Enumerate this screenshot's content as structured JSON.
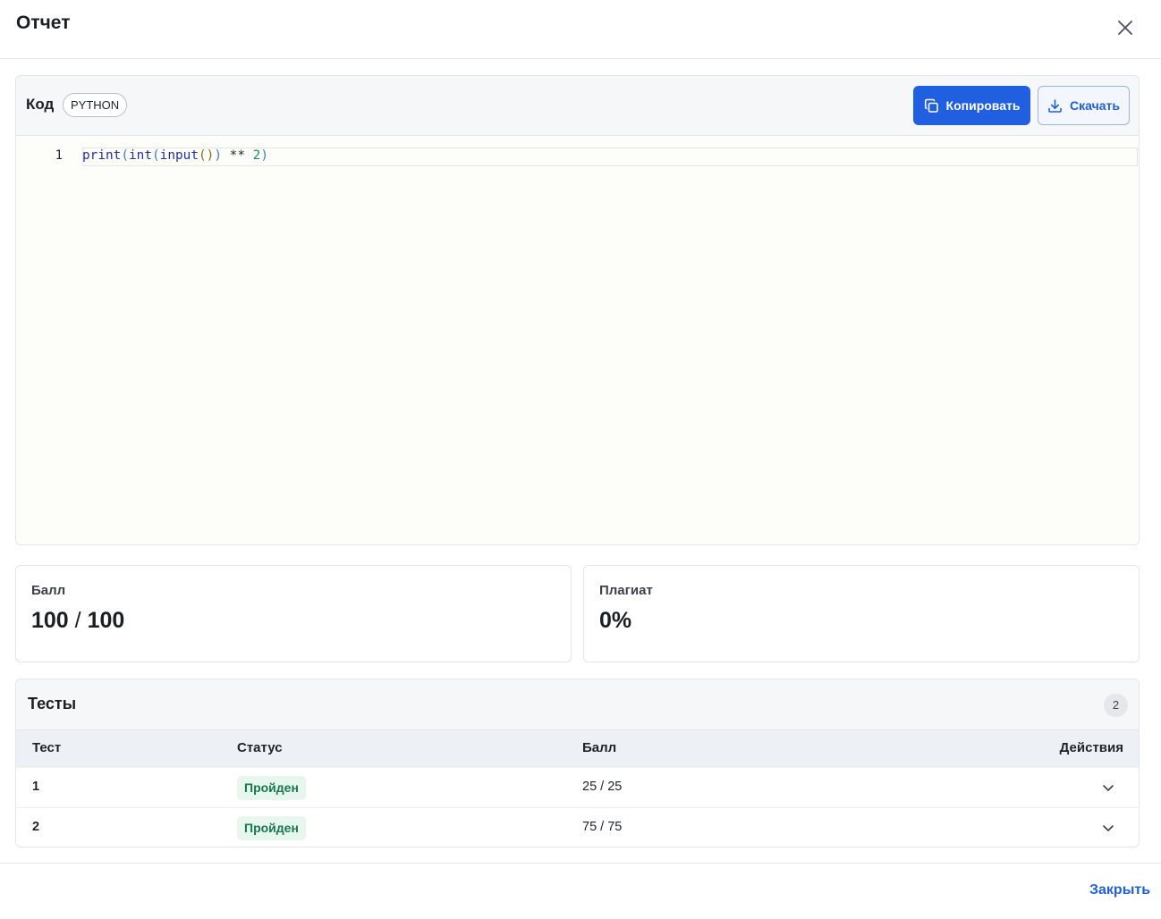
{
  "modal": {
    "title": "Отчет",
    "close_icon": "close-icon"
  },
  "code": {
    "label": "Код",
    "language": "PYTHON",
    "copy_label": "Копировать",
    "download_label": "Скачать",
    "lines": [
      {
        "number": "1",
        "text": "print(int(input()) ** 2)"
      }
    ]
  },
  "score": {
    "label": "Балл",
    "value": "100",
    "separator": "/",
    "max": "100"
  },
  "plagiarism": {
    "label": "Плагиат",
    "value": "0%"
  },
  "tests": {
    "title": "Тесты",
    "count": "2",
    "columns": {
      "test": "Тест",
      "status": "Статус",
      "score": "Балл",
      "actions": "Действия"
    },
    "rows": [
      {
        "test": "1",
        "status": "Пройден",
        "score": "25 / 25"
      },
      {
        "test": "2",
        "status": "Пройден",
        "score": "75 / 75"
      }
    ]
  },
  "footer": {
    "close_label": "Закрыть"
  },
  "colors": {
    "accent": "#1f5fe0",
    "success_bg": "#e7f6ee",
    "success_text": "#18794e"
  }
}
